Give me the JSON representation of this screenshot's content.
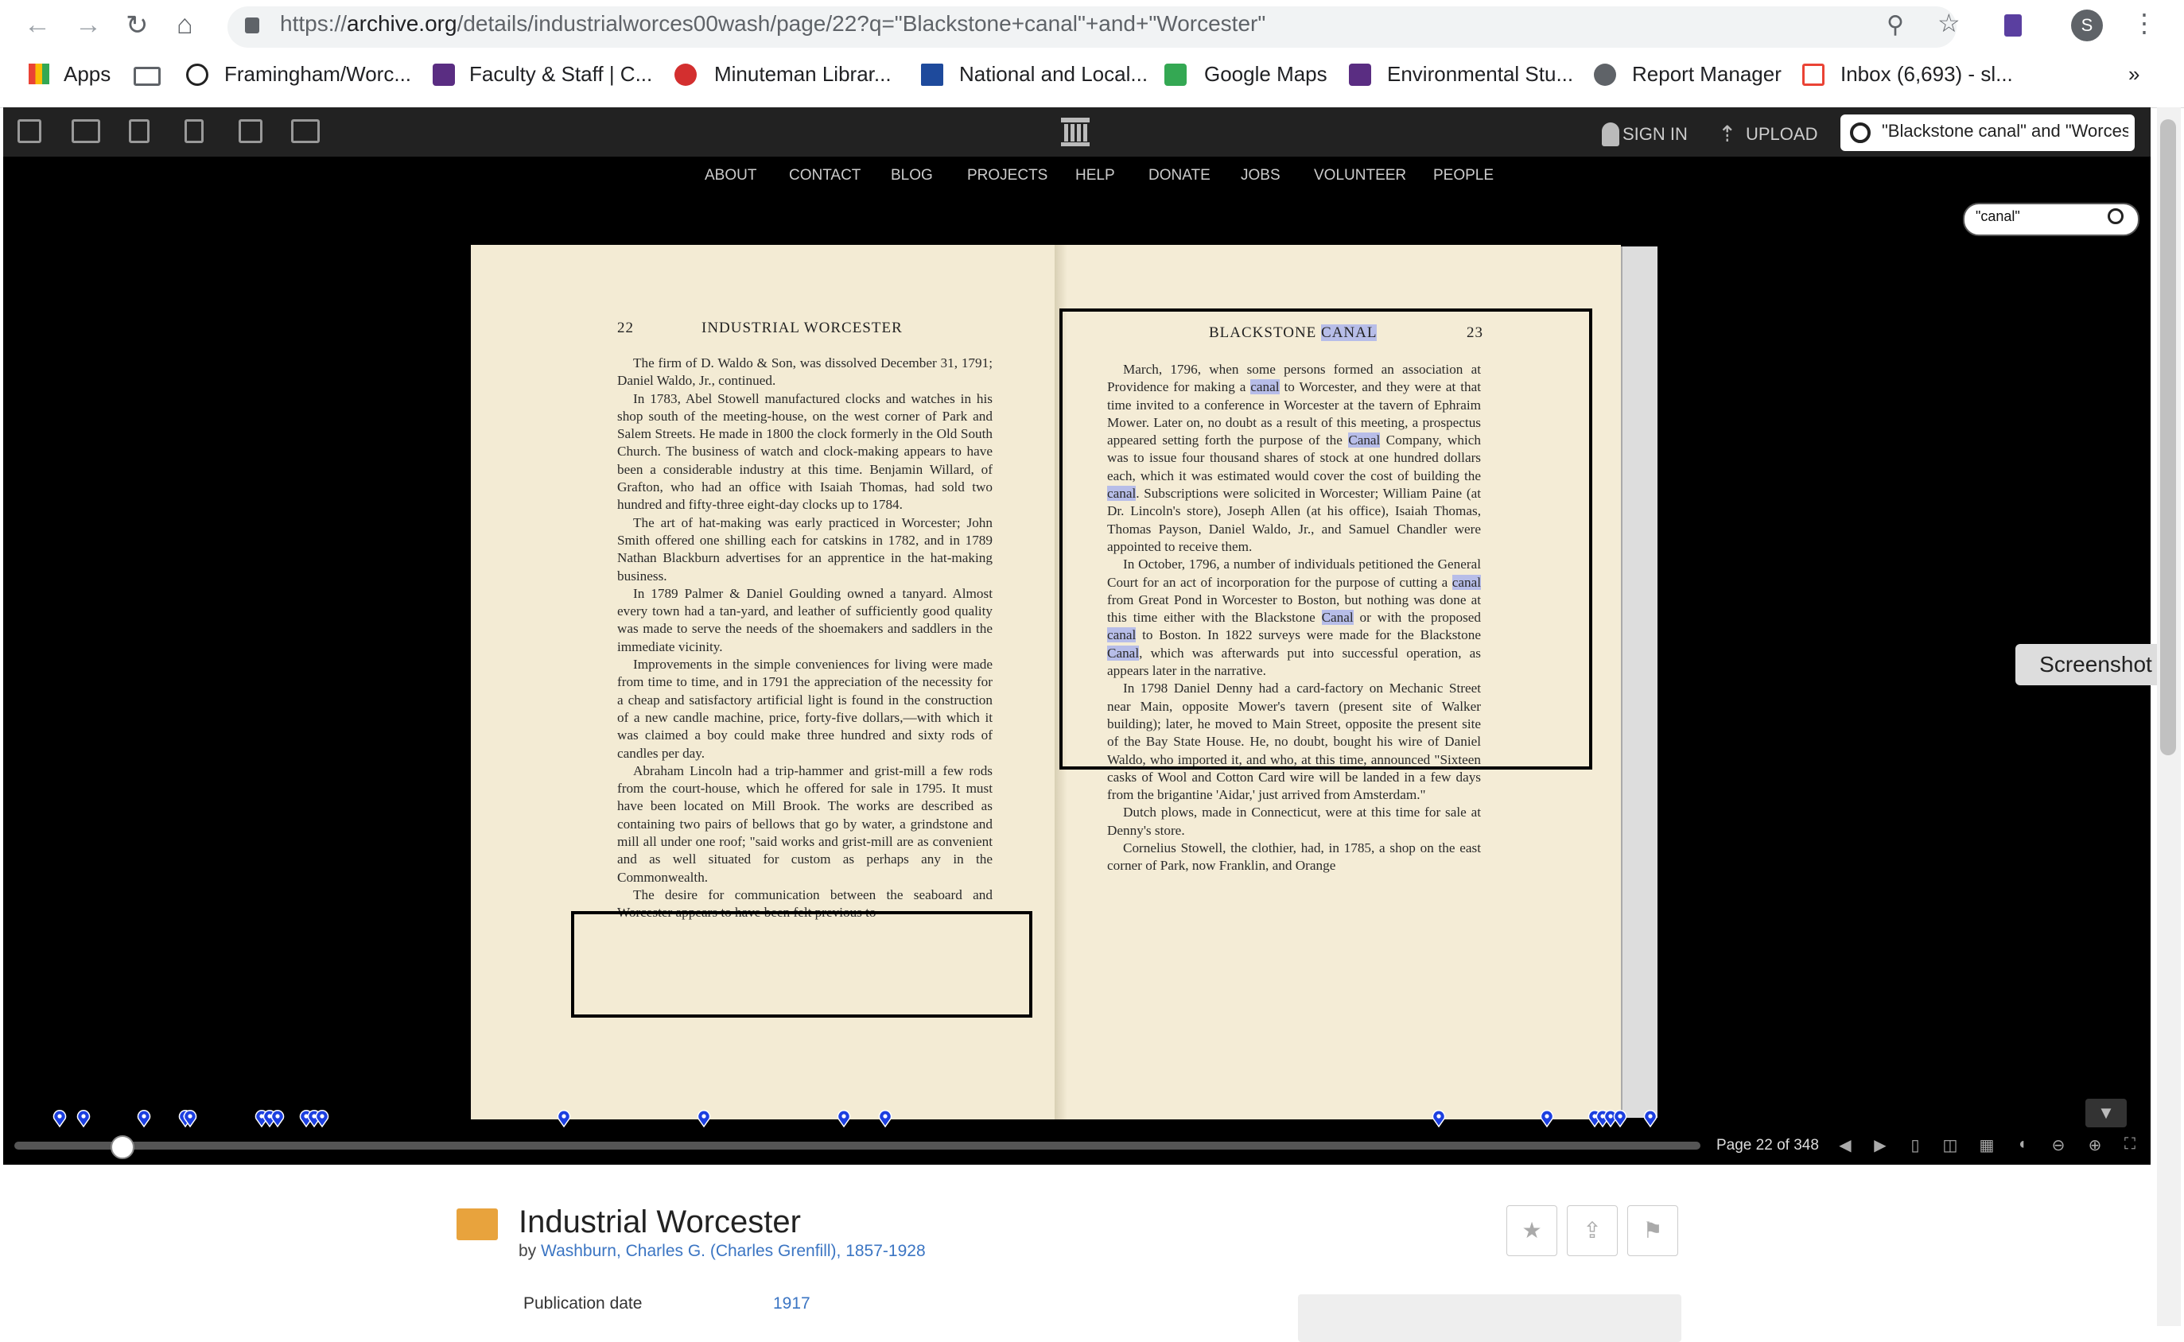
{
  "browser": {
    "url_domain": "archive.org",
    "url_prefix": "https://",
    "url_rest": "/details/industrialworces00wash/page/22?q=\"Blackstone+canal\"+and+\"Worcester\"",
    "bookmarks": [
      "Apps",
      "Framingham/Worc...",
      "Faculty & Staff | C...",
      "Minuteman Librar...",
      "National and Local...",
      "Google Maps",
      "Environmental Stu...",
      "Report Manager",
      "Inbox (6,693) - sl..."
    ],
    "more": "»",
    "profile_initial": "S"
  },
  "archive": {
    "menu": [
      "ABOUT",
      "CONTACT",
      "BLOG",
      "PROJECTS",
      "HELP",
      "DONATE",
      "JOBS",
      "VOLUNTEER",
      "PEOPLE"
    ],
    "sign_in": "SIGN IN",
    "upload": "UPLOAD",
    "search_value": "\"Blackstone canal\" and \"Worcester\"",
    "inbook_search": "\"canal\""
  },
  "book": {
    "left_page_num": "22",
    "left_header": "INDUSTRIAL WORCESTER",
    "right_header": "BLACKSTONE",
    "right_header_hl": "CANAL",
    "right_page_num": "23",
    "page_info": "Page 22 of 348",
    "progress": 0.063
  },
  "item": {
    "title": "Industrial Worcester",
    "by": "by",
    "author": "Washburn, Charles G. (Charles Grenfill), 1857-1928",
    "pub_label": "Publication date",
    "pub_value": "1917"
  },
  "overlay": {
    "screenshot": "Screenshot"
  },
  "colors": {
    "highlight": "#b7bde8",
    "link": "#3b75c3",
    "pin": "#1c3fe0"
  }
}
